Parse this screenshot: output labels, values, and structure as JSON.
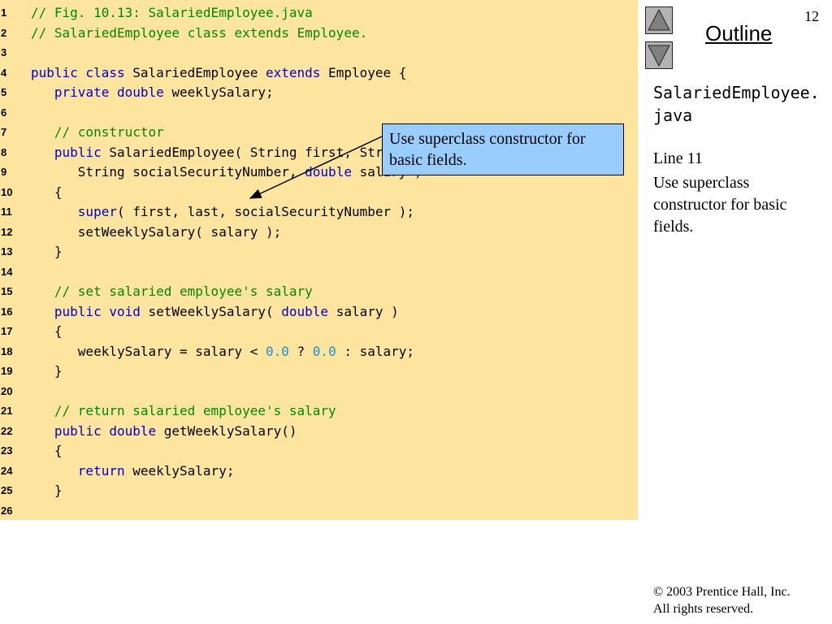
{
  "slide": {
    "page_number": "12",
    "outline_link": "Outline",
    "filename": "SalariedEmployee.java",
    "line_ref": "Line 11",
    "description": "Use superclass constructor for basic fields.",
    "copyright_symbol": "©",
    "copyright_line1": " 2003 Prentice Hall, Inc.",
    "copyright_line2": "All rights reserved."
  },
  "nav": {
    "up_icon": "triangle-up-icon",
    "down_icon": "triangle-down-icon"
  },
  "callout": {
    "text": "Use superclass constructor for basic fields.",
    "background": "#99ccff"
  },
  "colors": {
    "code_background": "#fde59f",
    "keyword": "#0000cc",
    "comment": "#008800",
    "number": "#1a8fd9",
    "plain": "#000000"
  },
  "code": [
    {
      "n": "1",
      "tokens": [
        {
          "t": "// Fig. 10.13: SalariedEmployee.java",
          "c": "comment"
        }
      ]
    },
    {
      "n": "2",
      "tokens": [
        {
          "t": "// SalariedEmployee class extends Employee.",
          "c": "comment"
        }
      ]
    },
    {
      "n": "3",
      "tokens": []
    },
    {
      "n": "4",
      "tokens": [
        {
          "t": "public class",
          "c": "kw"
        },
        {
          "t": " SalariedEmployee ",
          "c": "plain"
        },
        {
          "t": "extends",
          "c": "kw"
        },
        {
          "t": " Employee {",
          "c": "plain"
        }
      ]
    },
    {
      "n": "5",
      "tokens": [
        {
          "t": "   ",
          "c": "plain"
        },
        {
          "t": "private double",
          "c": "kw"
        },
        {
          "t": " weeklySalary;",
          "c": "plain"
        }
      ]
    },
    {
      "n": "6",
      "tokens": []
    },
    {
      "n": "7",
      "tokens": [
        {
          "t": "   // constructor",
          "c": "comment"
        }
      ]
    },
    {
      "n": "8",
      "tokens": [
        {
          "t": "   ",
          "c": "plain"
        },
        {
          "t": "public",
          "c": "kw"
        },
        {
          "t": " SalariedEmployee( String first, String last,",
          "c": "plain"
        }
      ]
    },
    {
      "n": "9",
      "tokens": [
        {
          "t": "      String socialSecurityNumber, ",
          "c": "plain"
        },
        {
          "t": "double",
          "c": "kw"
        },
        {
          "t": " salary )",
          "c": "plain"
        }
      ]
    },
    {
      "n": "10",
      "tokens": [
        {
          "t": "   {",
          "c": "plain"
        }
      ]
    },
    {
      "n": "11",
      "tokens": [
        {
          "t": "      ",
          "c": "plain"
        },
        {
          "t": "super",
          "c": "kw"
        },
        {
          "t": "( first, last, socialSecurityNumber );",
          "c": "plain"
        }
      ]
    },
    {
      "n": "12",
      "tokens": [
        {
          "t": "      setWeeklySalary( salary );",
          "c": "plain"
        }
      ]
    },
    {
      "n": "13",
      "tokens": [
        {
          "t": "   }",
          "c": "plain"
        }
      ]
    },
    {
      "n": "14",
      "tokens": []
    },
    {
      "n": "15",
      "tokens": [
        {
          "t": "   // set salaried employee's salary",
          "c": "comment"
        }
      ]
    },
    {
      "n": "16",
      "tokens": [
        {
          "t": "   ",
          "c": "plain"
        },
        {
          "t": "public void",
          "c": "kw"
        },
        {
          "t": " setWeeklySalary( ",
          "c": "plain"
        },
        {
          "t": "double",
          "c": "kw"
        },
        {
          "t": " salary )",
          "c": "plain"
        }
      ]
    },
    {
      "n": "17",
      "tokens": [
        {
          "t": "   {",
          "c": "plain"
        }
      ]
    },
    {
      "n": "18",
      "tokens": [
        {
          "t": "      weeklySalary = salary < ",
          "c": "plain"
        },
        {
          "t": "0.0",
          "c": "num"
        },
        {
          "t": " ? ",
          "c": "plain"
        },
        {
          "t": "0.0",
          "c": "num"
        },
        {
          "t": " : salary;",
          "c": "plain"
        }
      ]
    },
    {
      "n": "19",
      "tokens": [
        {
          "t": "   }",
          "c": "plain"
        }
      ]
    },
    {
      "n": "20",
      "tokens": []
    },
    {
      "n": "21",
      "tokens": [
        {
          "t": "   // return salaried employee's salary",
          "c": "comment"
        }
      ]
    },
    {
      "n": "22",
      "tokens": [
        {
          "t": "   ",
          "c": "plain"
        },
        {
          "t": "public double",
          "c": "kw"
        },
        {
          "t": " getWeeklySalary()",
          "c": "plain"
        }
      ]
    },
    {
      "n": "23",
      "tokens": [
        {
          "t": "   {",
          "c": "plain"
        }
      ]
    },
    {
      "n": "24",
      "tokens": [
        {
          "t": "      ",
          "c": "plain"
        },
        {
          "t": "return",
          "c": "kw"
        },
        {
          "t": " weeklySalary;",
          "c": "plain"
        }
      ]
    },
    {
      "n": "25",
      "tokens": [
        {
          "t": "   }",
          "c": "plain"
        }
      ]
    },
    {
      "n": "26",
      "tokens": []
    }
  ]
}
